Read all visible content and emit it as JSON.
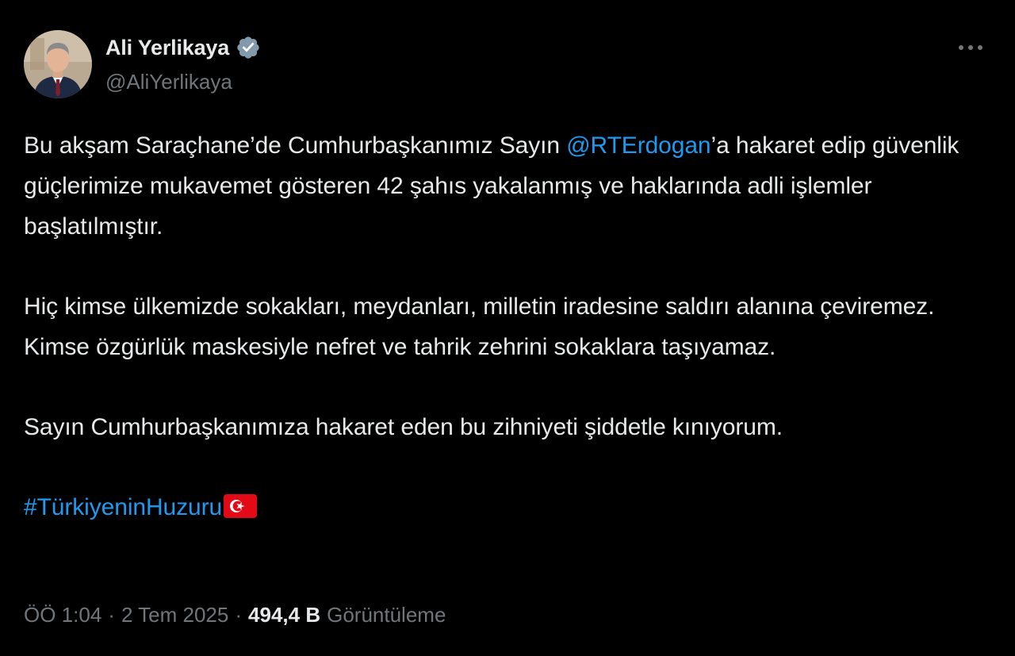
{
  "author": {
    "display_name": "Ali Yerlikaya",
    "handle": "@AliYerlikaya",
    "verified_icon": "verified-badge-icon",
    "avatar_icon": "avatar"
  },
  "menu": {
    "more_icon": "more-options-icon",
    "more_glyph": "···"
  },
  "tweet": {
    "p1_before": "Bu akşam Saraçhane’de Cumhurbaşkanımız Sayın ",
    "p1_mention": "@RTErdogan",
    "p1_after": "’a hakaret edip güvenlik güçlerimize mukavemet gösteren 42 şahıs yakalanmış ve haklarında adli işlemler başlatılmıştır.",
    "p2": "Hiç kimse ülkemizde sokakları, meydanları, milletin iradesine saldırı alanına çeviremez. Kimse özgürlük maskesiyle nefret ve tahrik zehrini sokaklara taşıyamaz.",
    "p3": "Sayın Cumhurbaşkanımıza hakaret eden bu zihniyeti şiddetle kınıyorum.",
    "hashtag": "#TürkiyeninHuzuru",
    "flag_icon": "turkey-flag-icon"
  },
  "meta": {
    "time": "ÖÖ 1:04",
    "separator": "·",
    "date": "2 Tem 2025",
    "views_count": "494,4 B",
    "views_label": "Görüntüleme"
  },
  "colors": {
    "background": "#000000",
    "text": "#e7e9ea",
    "secondary": "#71767b",
    "accent": "#1d9bf0",
    "verified": "#829aab",
    "flag_red": "#e30a17"
  }
}
